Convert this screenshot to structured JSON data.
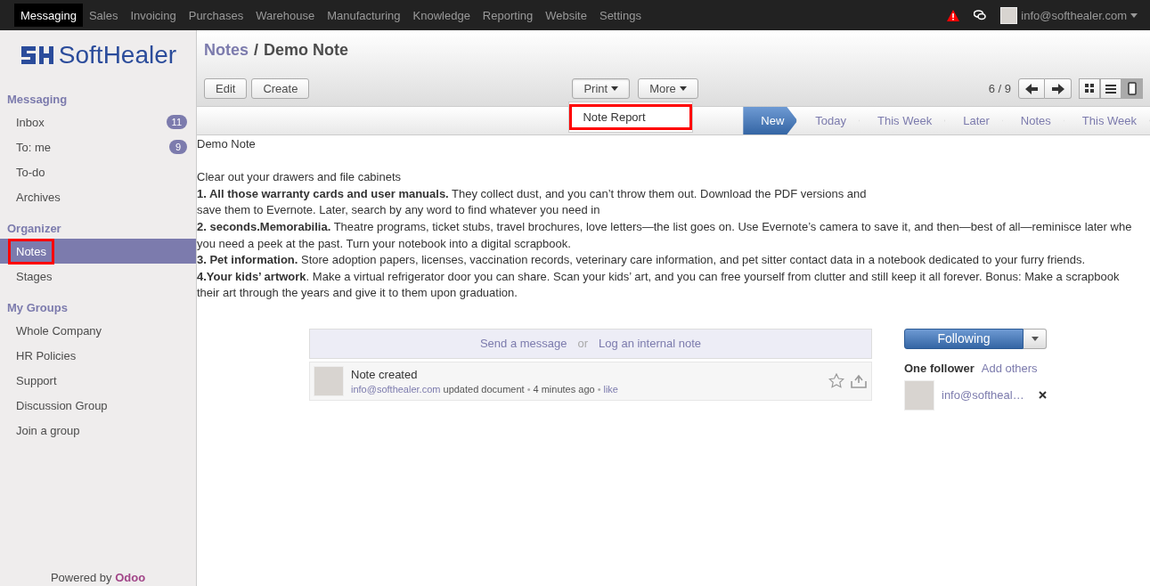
{
  "top_menu": [
    {
      "label": "Messaging",
      "selected": true
    },
    {
      "label": "Sales",
      "selected": false
    },
    {
      "label": "Invoicing",
      "selected": false
    },
    {
      "label": "Purchases",
      "selected": false
    },
    {
      "label": "Warehouse",
      "selected": false
    },
    {
      "label": "Manufacturing",
      "selected": false
    },
    {
      "label": "Knowledge",
      "selected": false
    },
    {
      "label": "Reporting",
      "selected": false
    },
    {
      "label": "Website",
      "selected": false
    },
    {
      "label": "Settings",
      "selected": false
    }
  ],
  "user": {
    "email": "info@softhealer.com"
  },
  "logo": {
    "text": "SoftHealer"
  },
  "sidebar": {
    "sections": [
      {
        "title": "Messaging",
        "items": [
          {
            "label": "Inbox",
            "count": "11",
            "selected": false,
            "annotated": false
          },
          {
            "label": "To: me",
            "count": "9",
            "selected": false,
            "annotated": false
          },
          {
            "label": "To-do",
            "selected": false,
            "annotated": false
          },
          {
            "label": "Archives",
            "selected": false,
            "annotated": false
          }
        ]
      },
      {
        "title": "Organizer",
        "items": [
          {
            "label": "Notes",
            "selected": true,
            "annotated": true
          },
          {
            "label": "Stages",
            "selected": false,
            "annotated": false
          }
        ]
      },
      {
        "title": "My Groups",
        "items": [
          {
            "label": "Whole Company",
            "selected": false,
            "annotated": false
          },
          {
            "label": "HR Policies",
            "selected": false,
            "annotated": false
          },
          {
            "label": "Support",
            "selected": false,
            "annotated": false
          },
          {
            "label": "Discussion Group",
            "selected": false,
            "annotated": false
          },
          {
            "label": "Join a group",
            "selected": false,
            "annotated": false
          }
        ]
      }
    ],
    "footer": {
      "text": "Powered by",
      "brand": "Odoo"
    }
  },
  "breadcrumb": {
    "parent": "Notes",
    "separator": "/",
    "current": "Demo Note"
  },
  "buttons": [
    "Edit",
    "Create"
  ],
  "dropdowns": [
    {
      "label": "Print",
      "expanded": true,
      "items": [
        {
          "label": "Note Report",
          "annotated": true
        }
      ]
    },
    {
      "label": "More",
      "expanded": false
    }
  ],
  "pager": "6 / 9",
  "views": [
    {
      "kind": "kanban",
      "selected": false
    },
    {
      "kind": "list",
      "selected": false
    },
    {
      "kind": "form",
      "selected": true
    }
  ],
  "stages": [
    {
      "label": "New",
      "selected": true
    },
    {
      "label": "Today",
      "selected": false
    },
    {
      "label": "This Week",
      "selected": false
    },
    {
      "label": "Later",
      "selected": false
    },
    {
      "label": "Notes",
      "selected": false
    },
    {
      "label": "This Week",
      "selected": false
    }
  ],
  "note": {
    "title": "Demo Note",
    "lines": [
      "Clear out your drawers and file cabinets",
      "**1. All those warranty cards and user manuals.** They collect dust, and you can’t throw them out. Download the PDF versions and",
      "save them to Evernote. Later, search by any word to find whatever you need in",
      "**2. seconds.Memorabilia.** Theatre programs, ticket stubs, travel brochures, love letters—the list goes on. Use Evernote’s camera to save it, and then—best of all—reminisce later whe",
      "you need a peek at the past. Turn your notebook into a digital scrapbook.",
      "**3. Pet information.** Store adoption papers, licenses, vaccination records, veterinary care information, and pet sitter contact data in a notebook dedicated to your furry friends.",
      "**4.Your kids’ artwork**. Make a virtual refrigerator door you can share. Scan your kids’ art, and you can free yourself from clutter and still keep it all forever. Bonus: Make a scrapbook",
      "their art through the years and give it to them upon graduation."
    ]
  },
  "chatter": {
    "send_message": "Send a message",
    "or": "or",
    "log_note": "Log an internal note",
    "messages": [
      {
        "title": "Note created",
        "author": "info@softhealer.com",
        "action": "updated document",
        "separator": "•",
        "time": "4 minutes ago",
        "like": "like",
        "starred": false
      }
    ]
  },
  "followers": {
    "button": "Following",
    "title": "One follower",
    "add": "Add others",
    "list": [
      {
        "name": "info@softheal…"
      }
    ]
  }
}
